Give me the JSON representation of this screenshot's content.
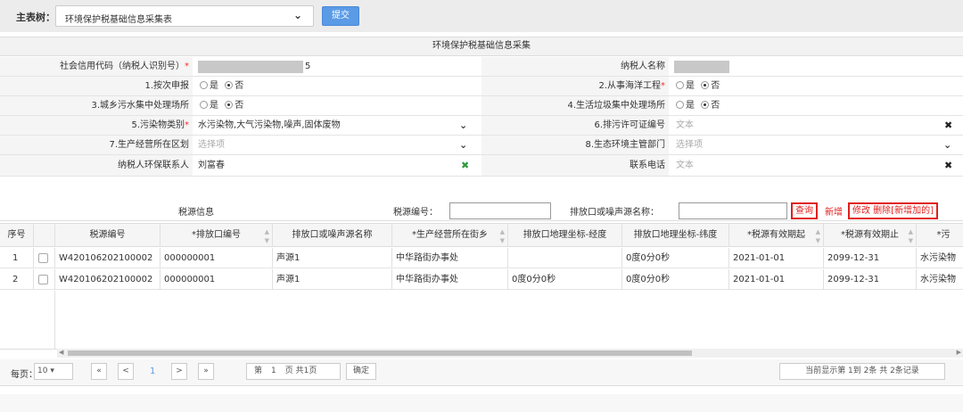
{
  "header": {
    "main_tree_label": "主表树：",
    "main_tree_value": "环境保护税基础信息采集表",
    "submit_label": "提交"
  },
  "form": {
    "title": "环境保护税基础信息采集",
    "credit_code_label": "社会信用代码（纳税人识别号）",
    "credit_code_tail": "5",
    "taxpayer_name_label": "纳税人名称",
    "q1_label": "1.按次申报",
    "q2_label": "2.从事海洋工程",
    "q3_label": "3.城乡污水集中处理场所",
    "q4_label": "4.生活垃圾集中处理场所",
    "yes": "是",
    "no": "否",
    "q5_label": "5.污染物类别",
    "q5_value": "水污染物,大气污染物,噪声,固体废物",
    "q6_label": "6.排污许可证编号",
    "q6_placeholder": "文本",
    "q7_label": "7.生产经营所在区划",
    "q7_placeholder": "选择项",
    "q8_label": "8.生态环境主管部门",
    "q8_placeholder": "选择项",
    "contact_label": "纳税人环保联系人",
    "contact_value": "刘富春",
    "phone_label": "联系电话",
    "phone_placeholder": "文本"
  },
  "search": {
    "title": "税源信息",
    "tax_no_label": "税源编号：",
    "outlet_name_label": "排放口或噪声源名称：",
    "query_label": "查询",
    "add_label": "新增",
    "edit_delete_label": "修改 删除[新增加的]"
  },
  "table": {
    "columns": [
      "序号",
      "",
      "税源编号",
      "*排放口编号",
      "排放口或噪声源名称",
      "*生产经营所在街乡",
      "排放口地理坐标-经度",
      "排放口地理坐标-纬度",
      "*税源有效期起",
      "*税源有效期止",
      "*污"
    ],
    "rows": [
      [
        "1",
        "",
        "W420106202100002",
        "000000001",
        "声源1",
        "中华路街办事处",
        "",
        "0度0分0秒",
        "2021-01-01",
        "2099-12-31",
        "水污染物"
      ],
      [
        "2",
        "",
        "W420106202100002",
        "000000001",
        "声源1",
        "中华路街办事处",
        "0度0分0秒",
        "0度0分0秒",
        "2021-01-01",
        "2099-12-31",
        "水污染物"
      ]
    ]
  },
  "pager": {
    "per_page_label": "每页：",
    "per_page_value": "10",
    "first": "«",
    "prev": "<",
    "current": "1",
    "next": ">",
    "last": "»",
    "page_prefix": "第",
    "page_input": "1",
    "page_suffix": "页 共1页",
    "confirm_label": "确定",
    "summary": "当前显示第  1到  2条 共  2条记录"
  }
}
